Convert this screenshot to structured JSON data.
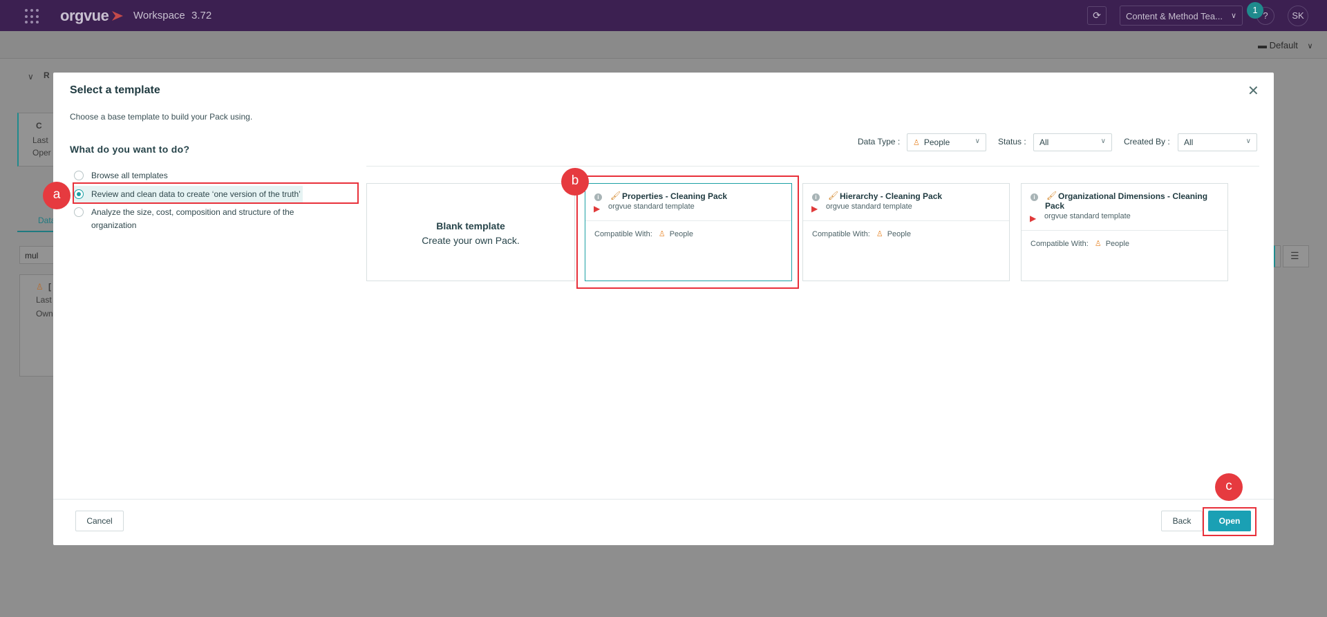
{
  "app": {
    "logo": "orgvue",
    "workspace_label": "Workspace",
    "version": "3.72",
    "team_select": "Content & Method Tea...",
    "notification_count": "1",
    "help": "?",
    "user_initials": "SK",
    "view_label": "Default"
  },
  "background": {
    "section_initial": "R",
    "card_initial": "C",
    "card_last": "Last",
    "card_open": "Oper",
    "tab_fragment": "Data",
    "search_value": "mul",
    "item_initial": "[",
    "item_last": "Last",
    "item_owner": "Own"
  },
  "modal": {
    "title": "Select a template",
    "subtitle": "Choose a base template to build your Pack using.",
    "question": "What do you want to do?",
    "options": [
      {
        "label": "Browse all templates",
        "selected": false
      },
      {
        "label": "Review and clean data to create ‘one version of the truth’",
        "selected": true
      },
      {
        "label": "Analyze the size, cost, composition and structure of the organization",
        "selected": false
      }
    ],
    "filters": {
      "data_type_label": "Data Type :",
      "data_type_value": "People",
      "status_label": "Status :",
      "status_value": "All",
      "created_by_label": "Created By :",
      "created_by_value": "All"
    },
    "blank": {
      "title": "Blank template",
      "subtitle": "Create your own Pack."
    },
    "templates": [
      {
        "title": "Properties - Cleaning Pack",
        "org": "orgvue standard template",
        "compat_label": "Compatible With:",
        "compat_value": "People"
      },
      {
        "title": "Hierarchy - Cleaning Pack",
        "org": "orgvue standard template",
        "compat_label": "Compatible With:",
        "compat_value": "People"
      },
      {
        "title": "Organizational Dimensions - Cleaning Pack",
        "org": "orgvue standard template",
        "compat_label": "Compatible With:",
        "compat_value": "People"
      }
    ],
    "buttons": {
      "cancel": "Cancel",
      "back": "Back",
      "open": "Open"
    }
  },
  "annotations": {
    "a": "a",
    "b": "b",
    "c": "c"
  },
  "colors": {
    "topbar": "#3c2051",
    "accent": "#1aa0b4",
    "highlight": "#e8303a"
  }
}
